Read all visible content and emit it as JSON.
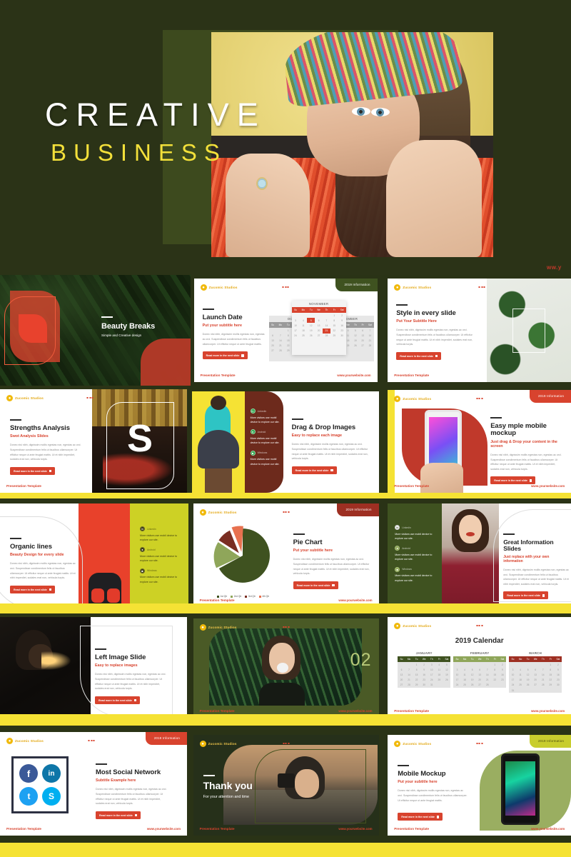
{
  "hero": {
    "title": "CREATIVE",
    "subtitle": "BUSINESS",
    "url_fragment": "ww.y"
  },
  "brand": {
    "logo_text": "Zucomic Studios",
    "badge_2019": "2019 Information",
    "footer_left": "Presentation Template",
    "footer_right": "www.yourwebsite.com",
    "button_label": "Read more in the next slide",
    "body_text": "Donec nisi nibh, dignissim mollis egestas non, egestas ac orci. Suspendisse condimentum felis ut faucibus ullamcorper. Ut efficitur neque ut ante feugiat mattis. Ut et nibh imperdiet, sodales erat non, vehicula turpis.",
    "body_text_short": "Donec nisi nibh, dignissim mollis egestas non, egestas ac orci. Suspendisse condimentum felis ut faucibus ullamcorper. Ut efficitur neque ut ante feugiat mattis."
  },
  "colors": {
    "dark_green": "#2b3317",
    "olive": "#3f5220",
    "red": "#d8432e",
    "dark_red": "#9e2f22",
    "yellow": "#f3e03a",
    "lime": "#c8cd2e",
    "sage": "#8fa65a"
  },
  "feature_items": [
    {
      "label": "Linkedin",
      "text": "More visitors use mobil device to explore our site."
    },
    {
      "label": "Android",
      "text": "More visitors use mobil device to explore our site."
    },
    {
      "label": "Windows",
      "text": "More visitors use mobil device to explore our site."
    }
  ],
  "slides": [
    {
      "n": 1,
      "title": "Beauty Breaks",
      "subtitle": "Simple and Creative design"
    },
    {
      "n": 2,
      "title": "Launch Date",
      "subtitle": "Put your subtitle here"
    },
    {
      "n": 3,
      "title": "Style in every slide",
      "subtitle": "Put Your Subtitle Here"
    },
    {
      "n": 4,
      "title": "Strengths Analysis",
      "subtitle": "Swot Analysis Slides"
    },
    {
      "n": 5,
      "title": "Drag & Drop Images",
      "subtitle": "Easy to replace each image"
    },
    {
      "n": 6,
      "title": "Easy mple mobile mockup",
      "subtitle": "Just drag & Drop your content in the screen"
    },
    {
      "n": 7,
      "title": "Organic lines",
      "subtitle": "Beauty Design for every slide"
    },
    {
      "n": 8,
      "title": "Pie Chart",
      "subtitle": "Put your subtitle here"
    },
    {
      "n": 9,
      "title": "Great Information Slides",
      "subtitle": "Just replace with your own information"
    },
    {
      "n": 10,
      "title": "Left Image Slide",
      "subtitle": "Easy to replace images"
    },
    {
      "n": 11,
      "title": "02",
      "subtitle": ""
    },
    {
      "n": 12,
      "title": "2019 Calendar",
      "subtitle": ""
    },
    {
      "n": 13,
      "title": "Most Social Network",
      "subtitle": "Subtitle Example here"
    },
    {
      "n": 14,
      "title": "Thank you",
      "subtitle": "For your attention and time"
    },
    {
      "n": 15,
      "title": "Mobile Mockup",
      "subtitle": "Put your subtitle here"
    }
  ],
  "calendar_november": {
    "month": "NOVEMBER",
    "weekdays": [
      "Su",
      "Mo",
      "Tu",
      "We",
      "Th",
      "Fr",
      "Sat"
    ],
    "lead_blanks": 5,
    "days": 30,
    "selected": [
      5,
      21
    ]
  },
  "calendar_october": {
    "month": "OCTOBER",
    "weekdays": [
      "Su",
      "Mo",
      "Tu",
      "We",
      "Th",
      "Fr",
      "Sat"
    ],
    "lead_blanks": 2,
    "days": 31
  },
  "calendar_december": {
    "month": "DECEMBER",
    "weekdays": [
      "Su",
      "Mo",
      "Tu",
      "We",
      "Th",
      "Fr",
      "Sat"
    ],
    "lead_blanks": 0,
    "days": 31
  },
  "calendar_2019": {
    "title": "2019 Calendar",
    "weekdays": [
      "Su",
      "Mo",
      "Tu",
      "We",
      "Th",
      "Fr",
      "Sat"
    ],
    "months": [
      {
        "name": "JANUARY",
        "header_color": "#3f5220",
        "lead_blanks": 2,
        "days": 31
      },
      {
        "name": "FEBRUARY",
        "header_color": "#8fa65a",
        "lead_blanks": 5,
        "days": 28
      },
      {
        "name": "MARCH",
        "header_color": "#9e2f22",
        "lead_blanks": 5,
        "days": 31
      }
    ]
  },
  "social": [
    {
      "name": "facebook",
      "glyph": "f",
      "color": "#3b5998"
    },
    {
      "name": "linkedin",
      "glyph": "in",
      "color": "#0e76a8"
    },
    {
      "name": "twitter",
      "glyph": "t",
      "color": "#1da1f2"
    },
    {
      "name": "skype",
      "glyph": "S",
      "color": "#00aff0"
    }
  ],
  "chart_data": {
    "type": "pie",
    "title": "Pie Chart",
    "subtitle": "Put your subtitle here",
    "categories": [
      "1st Qtr",
      "2nd Qtr",
      "3rd Qtr",
      "4th Qtr"
    ],
    "values": [
      58,
      20,
      12,
      10
    ],
    "colors": [
      "#3f5220",
      "#8fa65a",
      "#7a2e22",
      "#e8714f"
    ],
    "legend": "bottom",
    "xlabel": "",
    "ylabel": ""
  }
}
